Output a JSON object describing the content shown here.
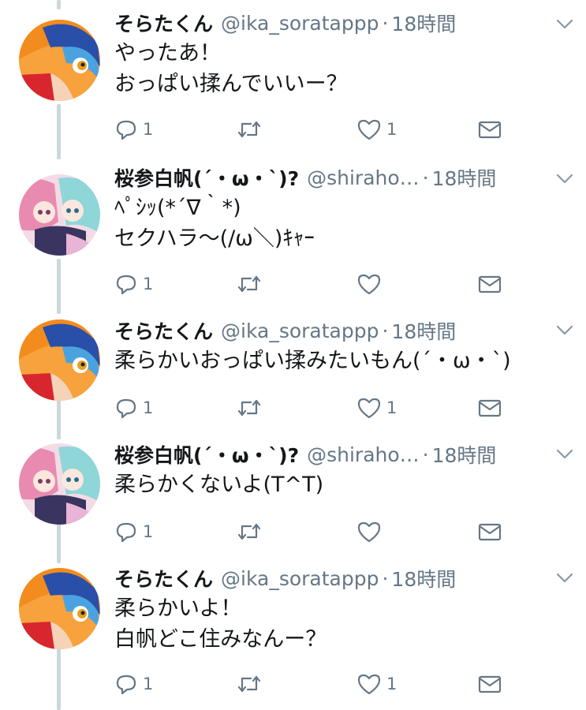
{
  "tweets": [
    {
      "name": "そらたくん",
      "handle": "@ika_soratappp",
      "separator": "·",
      "time": "18時間",
      "text": "やったあ！\nおっぱい揉んでいいー？",
      "reply_count": "1",
      "retweet_count": "",
      "like_count": "1",
      "avatar": "sora-avatar"
    },
    {
      "name": "桜参白帆(´・ω・`)?",
      "handle": "@shiraho…",
      "separator": "·",
      "time": "18時間",
      "text": "ﾍﾟｼｯ(*´∇｀*)\nセクハラ〜(/ω＼)ｷｬｰ",
      "reply_count": "1",
      "retweet_count": "",
      "like_count": "",
      "avatar": "shiraho-avatar"
    },
    {
      "name": "そらたくん",
      "handle": "@ika_soratappp",
      "separator": "·",
      "time": "18時間",
      "text": "柔らかいおっぱい揉みたいもん(´・ω・`)",
      "reply_count": "1",
      "retweet_count": "",
      "like_count": "1",
      "avatar": "sora-avatar"
    },
    {
      "name": "桜参白帆(´・ω・`)?",
      "handle": "@shiraho…",
      "separator": "·",
      "time": "18時間",
      "text": "柔らかくないよ(T^T)",
      "reply_count": "1",
      "retweet_count": "",
      "like_count": "",
      "avatar": "shiraho-avatar"
    },
    {
      "name": "そらたくん",
      "handle": "@ika_soratappp",
      "separator": "·",
      "time": "18時間",
      "text": "柔らかいよ！\n白帆どこ住みなんー？",
      "reply_count": "1",
      "retweet_count": "",
      "like_count": "1",
      "avatar": "sora-avatar"
    }
  ],
  "colors": {
    "text": "#14171a",
    "secondary": "#657786",
    "icon": "#657786",
    "thread_line": "#ccd6dd"
  }
}
